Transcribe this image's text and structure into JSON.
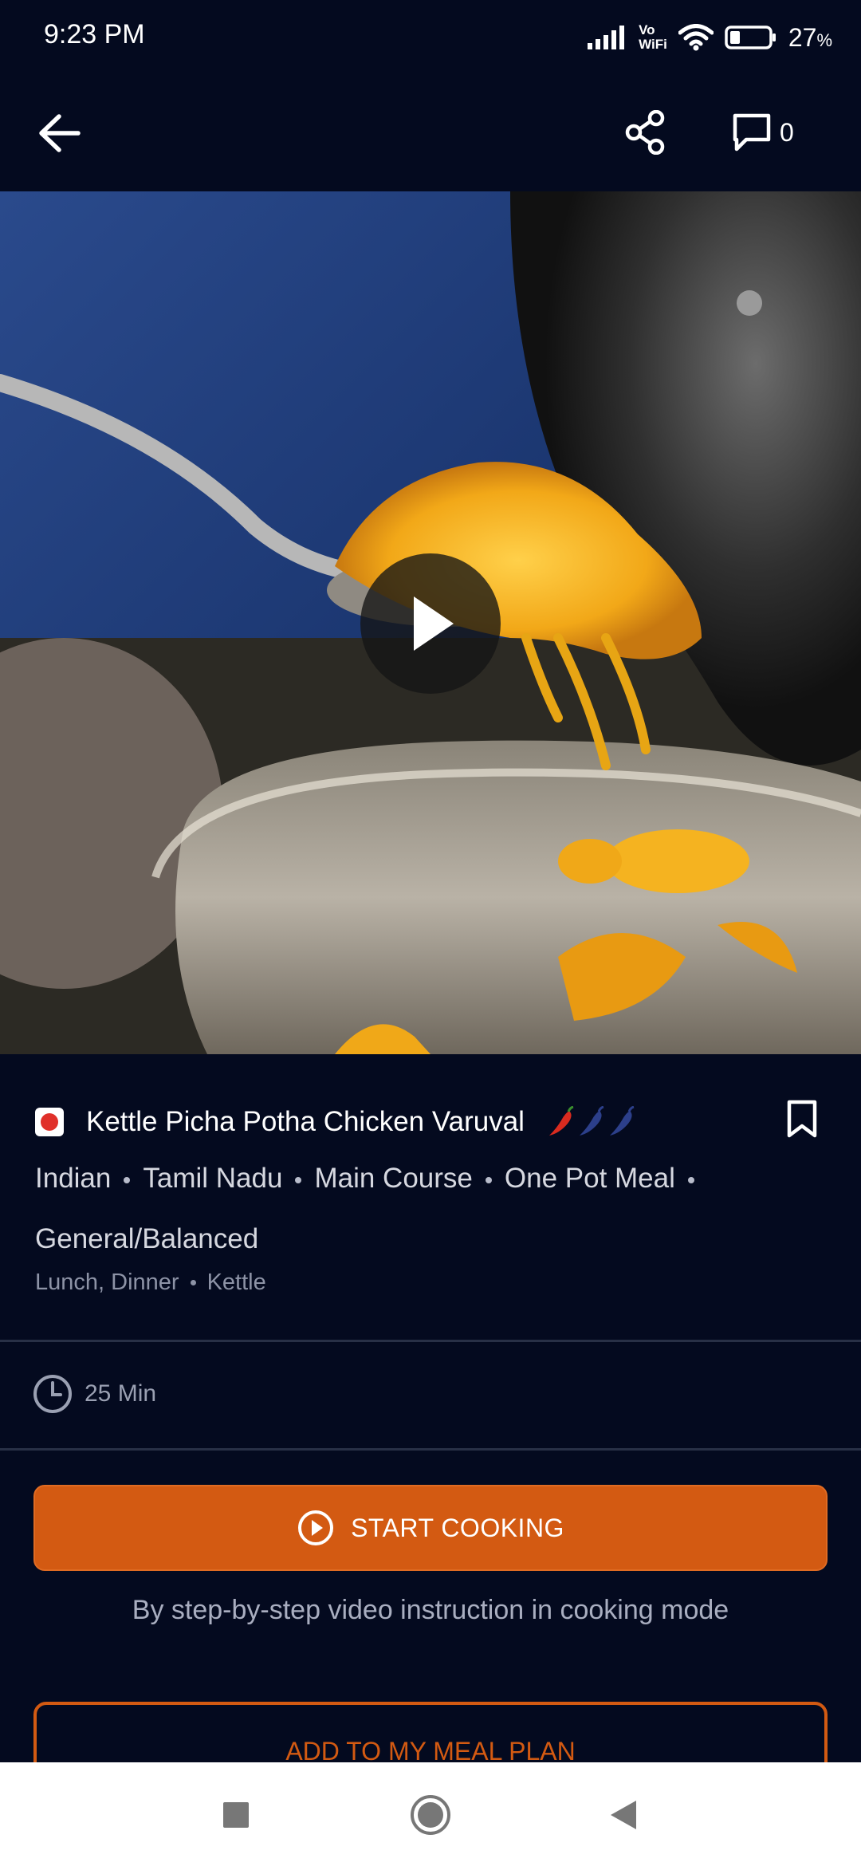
{
  "status_bar": {
    "time": "9:23 PM",
    "network_label_top": "Vo",
    "network_label_bottom": "WiFi",
    "battery_percent": "27",
    "battery_unit": "%",
    "battery_level": 0.27
  },
  "toolbar": {
    "back_icon": "arrow-left-icon",
    "share_icon": "share-icon",
    "comment_icon": "comment-icon",
    "comment_count": "0"
  },
  "hero": {
    "play_icon": "play-icon"
  },
  "recipe": {
    "title": "Kettle Picha Potha Chicken Varuval",
    "spice_level": 1,
    "spice_max": 3,
    "tags": [
      "Indian",
      "Tamil Nadu",
      "Main Course",
      "One Pot Meal",
      "General/Balanced"
    ],
    "meal_times": "Lunch, Dinner",
    "equipment": "Kettle",
    "duration": "25 Min"
  },
  "actions": {
    "start_cooking_label": "START COOKING",
    "start_cooking_helper": "By step-by-step video instruction in cooking mode",
    "add_meal_plan_label": "ADD TO MY MEAL PLAN"
  },
  "colors": {
    "background": "#040a1f",
    "accent": "#d35a12",
    "veg_dot": "#e0302a",
    "spice_active": "#d92b1f",
    "spice_inactive": "#2c3f8a"
  }
}
